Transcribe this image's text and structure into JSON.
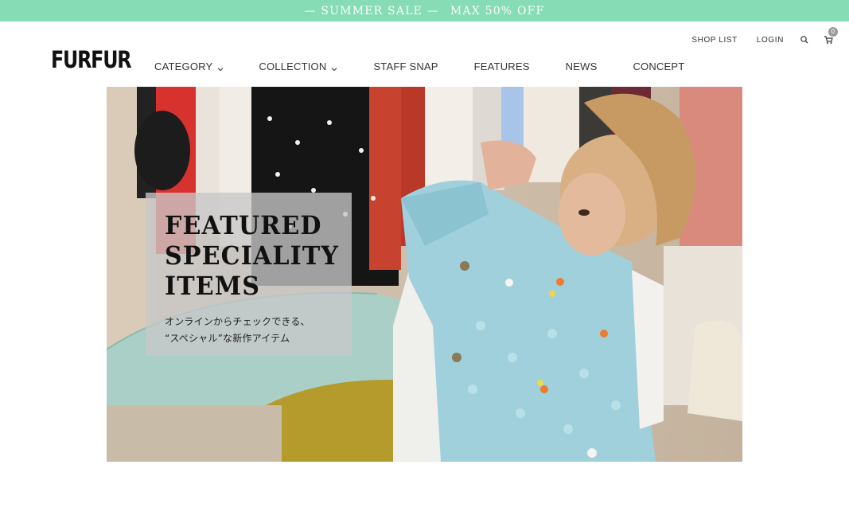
{
  "promo": {
    "part1": "— SUMMER SALE —",
    "part2": "MAX 50% OFF"
  },
  "header": {
    "logo": "FURFUR",
    "util_links": {
      "shop_list": "SHOP LIST",
      "login": "LOGIN"
    },
    "search_icon": "search-icon",
    "cart_icon": "cart-icon",
    "cart_count": "0"
  },
  "nav": {
    "category": "CATEGORY",
    "collection": "COLLECTION",
    "staff_snap": "STAFF SNAP",
    "features": "FEATURES",
    "news": "NEWS",
    "concept": "CONCEPT"
  },
  "hero": {
    "title_line1": "FEATURED",
    "title_line2": "SPECIALITY",
    "title_line3": "ITEMS",
    "subtitle_line1": "オンラインからチェックできる、",
    "subtitle_line2": "“スペシャル”な新作アイテム"
  },
  "colors": {
    "promo_bg": "#85dcb5",
    "cardigan": "#9fd0dc",
    "caption_bg": "#c8c8c8"
  }
}
